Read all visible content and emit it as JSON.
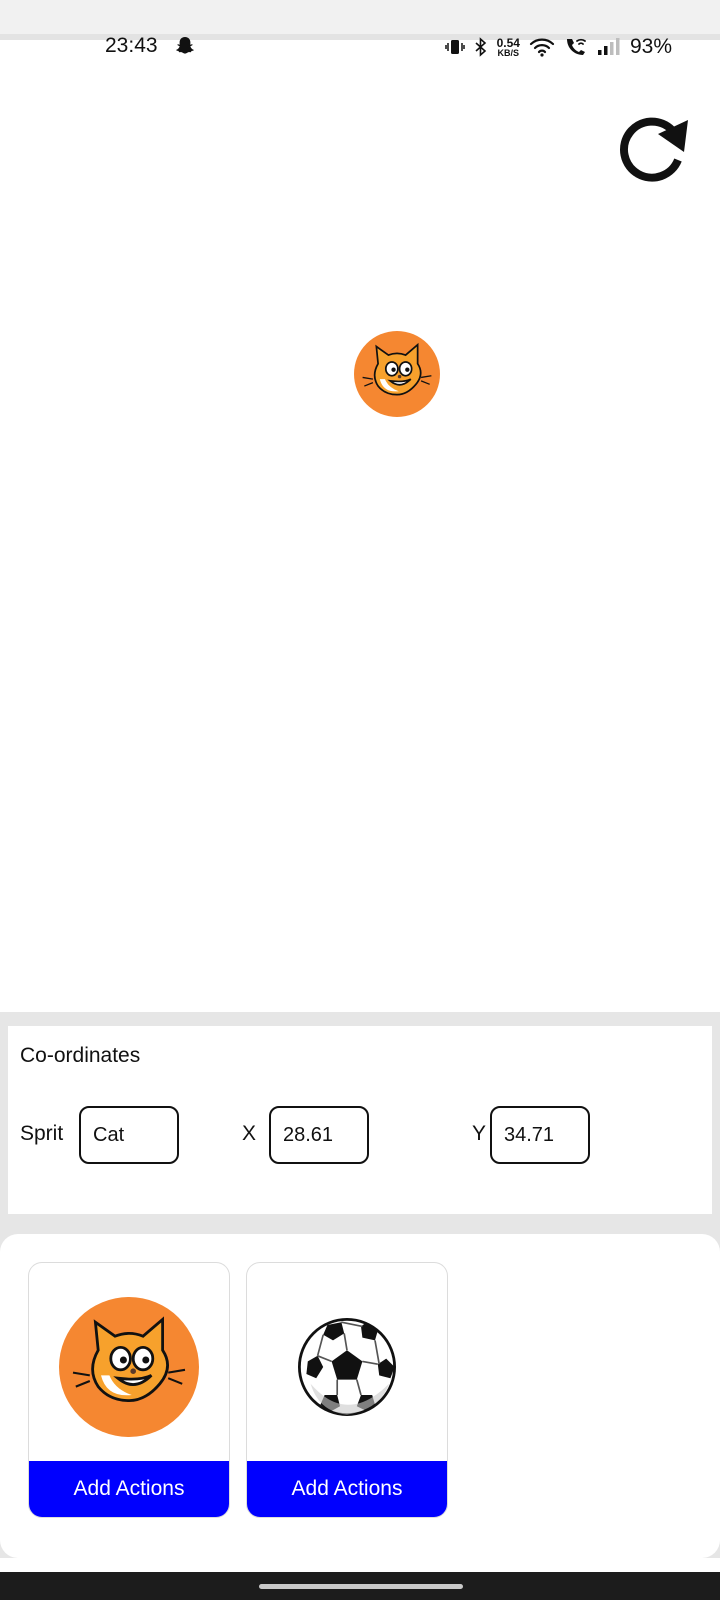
{
  "status_bar": {
    "time": "23:43",
    "network_speed_value": "0.54",
    "network_speed_unit": "KB/S",
    "battery_text": "93%",
    "icons": [
      "snapchat-icon",
      "vibrate-icon",
      "bluetooth-icon",
      "wifi-icon",
      "wifi-call-icon",
      "signal-icon"
    ]
  },
  "toolbar": {
    "refresh_icon": "refresh-icon"
  },
  "stage": {
    "sprite": "cat"
  },
  "coordinates": {
    "title": "Co-ordinates",
    "sprite_label": "Sprit",
    "sprite_value": "Cat",
    "x_label": "X",
    "x_value": "28.61",
    "y_label": "Y",
    "y_value": "34.71"
  },
  "sprites": [
    {
      "name": "cat",
      "action_label": "Add Actions"
    },
    {
      "name": "ball",
      "action_label": "Add Actions"
    }
  ],
  "colors": {
    "accent": "#0000ff",
    "cat_orange": "#f58731"
  }
}
